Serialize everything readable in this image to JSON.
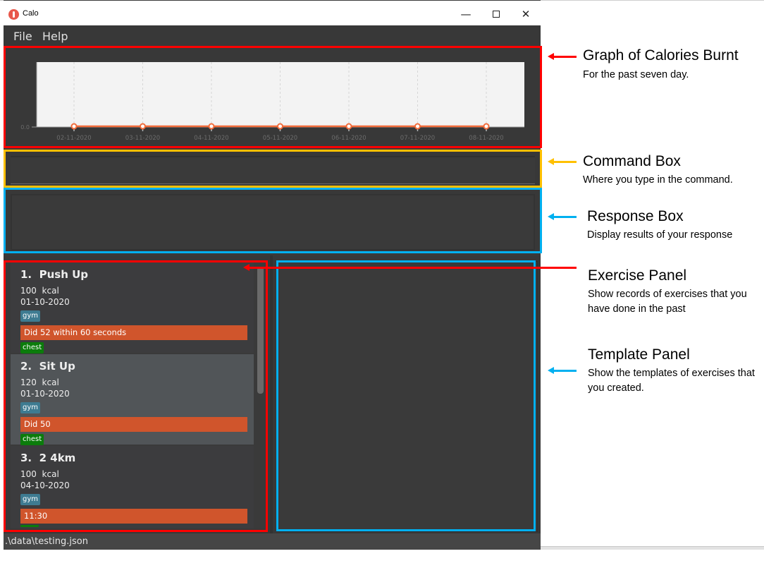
{
  "window": {
    "title": "Calo",
    "controls": {
      "minimize": "—",
      "close": "✕"
    }
  },
  "menu": {
    "items": [
      {
        "label": "File"
      },
      {
        "label": "Help"
      }
    ]
  },
  "chart_data": {
    "type": "line",
    "title": "",
    "xlabel": "",
    "ylabel": "",
    "categories": [
      "02-11-2020",
      "03-11-2020",
      "04-11-2020",
      "05-11-2020",
      "06-11-2020",
      "07-11-2020",
      "08-11-2020"
    ],
    "series": [
      {
        "name": "Calories Burnt",
        "values": [
          0,
          0,
          0,
          0,
          0,
          0,
          0
        ],
        "color": "#f26b3a"
      }
    ],
    "y_tick_labels": [
      "0.0"
    ],
    "ylim": [
      0,
      1
    ],
    "grid": true
  },
  "command_box": {
    "value": "",
    "placeholder": ""
  },
  "response_box": {
    "value": ""
  },
  "exercises": [
    {
      "index": "1.",
      "name": "Push Up",
      "calories": "100",
      "unit": "kcal",
      "date": "01-10-2020",
      "tag": "gym",
      "description": "Did 52 within 60 seconds",
      "muscle": "chest"
    },
    {
      "index": "2.",
      "name": "Sit Up",
      "calories": "120",
      "unit": "kcal",
      "date": "01-10-2020",
      "tag": "gym",
      "description": "Did 50",
      "muscle": "chest"
    },
    {
      "index": "3.",
      "name": "2 4km",
      "calories": "100",
      "unit": "kcal",
      "date": "04-10-2020",
      "tag": "gym",
      "description": "11:30",
      "muscle": ""
    }
  ],
  "status_bar": {
    "path": ".\\data\\testing.json"
  },
  "annotations": [
    {
      "title": "Graph of Calories Burnt",
      "desc": "For the past seven day.",
      "color": "#ff0000"
    },
    {
      "title": "Command Box",
      "desc": "Where you type in the command.",
      "color": "#ffc000"
    },
    {
      "title": "Response Box",
      "desc": "Display results of your response",
      "color": "#00b0f0"
    },
    {
      "title": "Exercise Panel",
      "desc": "Show records of exercises that you have done in the past",
      "color": "#ff0000"
    },
    {
      "title": "Template Panel",
      "desc": "Show the templates of exercises that you created.",
      "color": "#00b0f0"
    }
  ]
}
